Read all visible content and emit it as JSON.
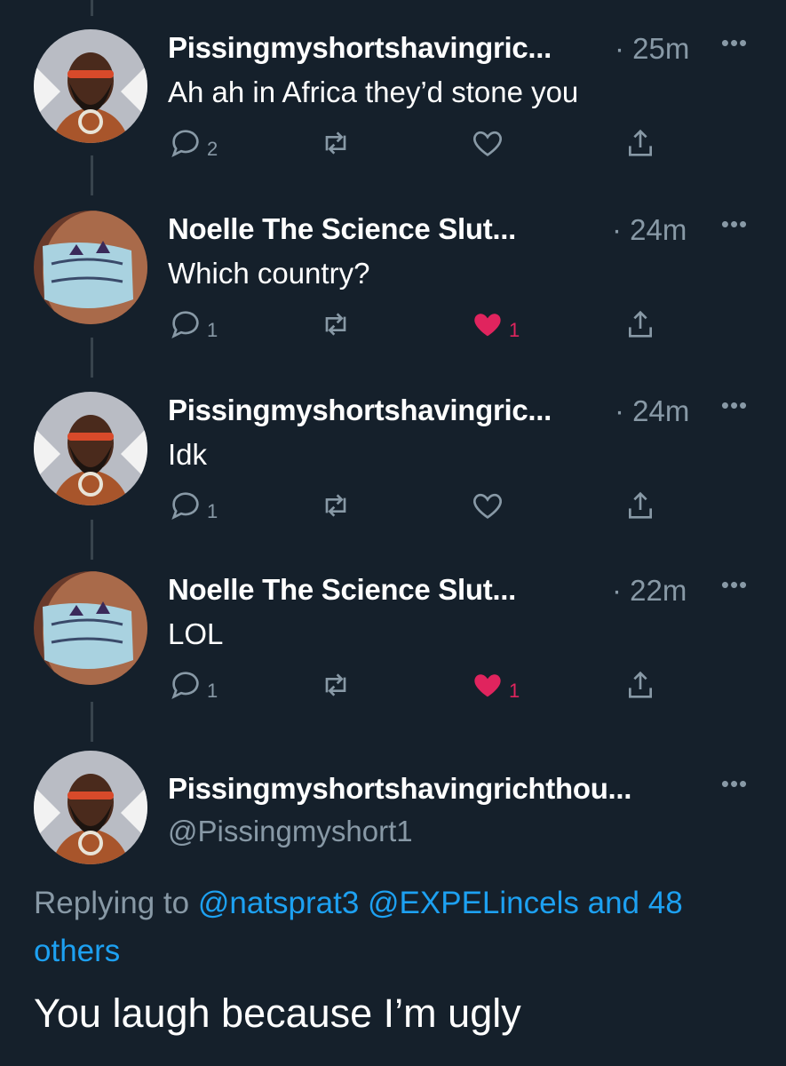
{
  "thread": [
    {
      "name": "Pissingmyshortshavingric...",
      "time": "· 25m",
      "text": "Ah ah in Africa they’d stone you",
      "avatar_icon": "man-sunglasses-avatar",
      "replies": "2",
      "retweets": "",
      "likes": "",
      "liked": false
    },
    {
      "name": "Noelle The Science Slut...",
      "time": "· 24m",
      "text": "Which country?",
      "avatar_icon": "woman-mask-avatar",
      "replies": "1",
      "retweets": "",
      "likes": "1",
      "liked": true
    },
    {
      "name": "Pissingmyshortshavingric...",
      "time": "· 24m",
      "text": "Idk",
      "avatar_icon": "man-sunglasses-avatar",
      "replies": "1",
      "retweets": "",
      "likes": "",
      "liked": false
    },
    {
      "name": "Noelle The Science Slut...",
      "time": "· 22m",
      "text": "LOL",
      "avatar_icon": "woman-mask-avatar",
      "replies": "1",
      "retweets": "",
      "likes": "1",
      "liked": true
    }
  ],
  "main_tweet": {
    "name": "Pissingmyshortshavingrichthou...",
    "handle": "@Pissingmyshort1",
    "replying_prefix": "Replying to",
    "replying_users": "@natsprat3 @EXPELincels",
    "replying_others": "and 48 others",
    "text": "You laugh because I’m ugly"
  },
  "colors": {
    "background": "#15202b",
    "muted": "#8899a6",
    "link": "#1da1f2",
    "like": "#e0245e",
    "thread_line": "#38444d"
  }
}
